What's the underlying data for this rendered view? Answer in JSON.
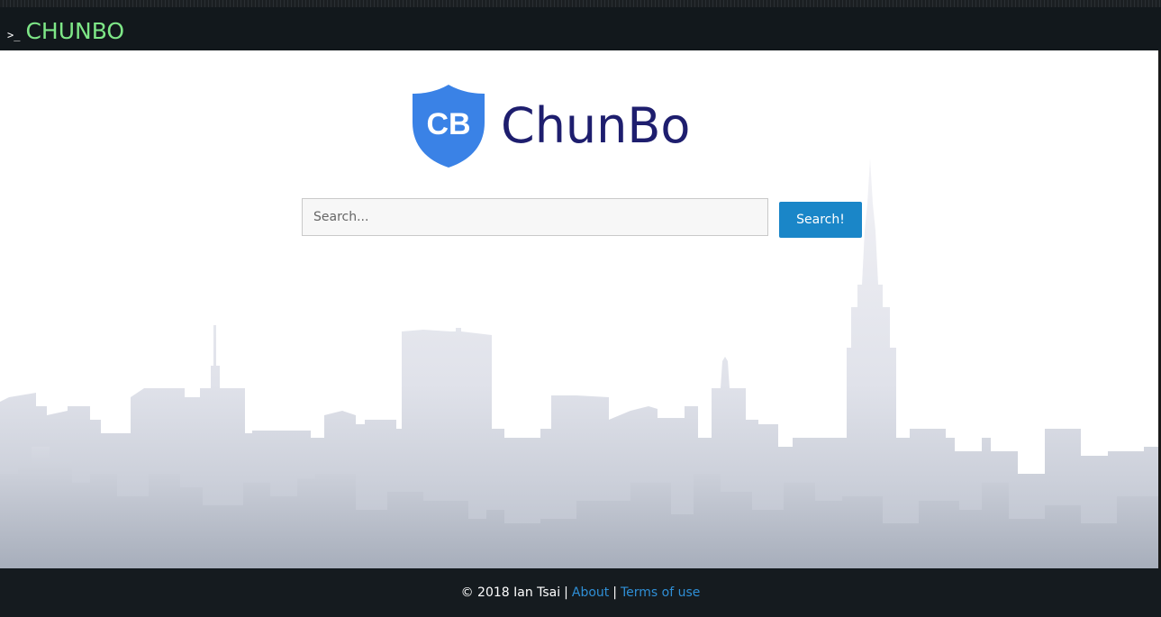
{
  "navbar": {
    "prompt_symbol": ">_",
    "brand": "CHUNBO"
  },
  "logo": {
    "icon_letters": "CB",
    "text": "ChunBo",
    "shield_color": "#3a82e6",
    "text_color": "#1e1e6e"
  },
  "search": {
    "placeholder": "Search...",
    "button_label": "Search!"
  },
  "footer": {
    "copyright": "© 2018 Ian Tsai",
    "separator": "|",
    "about_link": "About",
    "terms_link": "Terms of use"
  },
  "colors": {
    "accent": "#1a86c8",
    "brand_green": "#7ee787",
    "navbar_bg": "#12181c",
    "link": "#2f8fd6"
  }
}
